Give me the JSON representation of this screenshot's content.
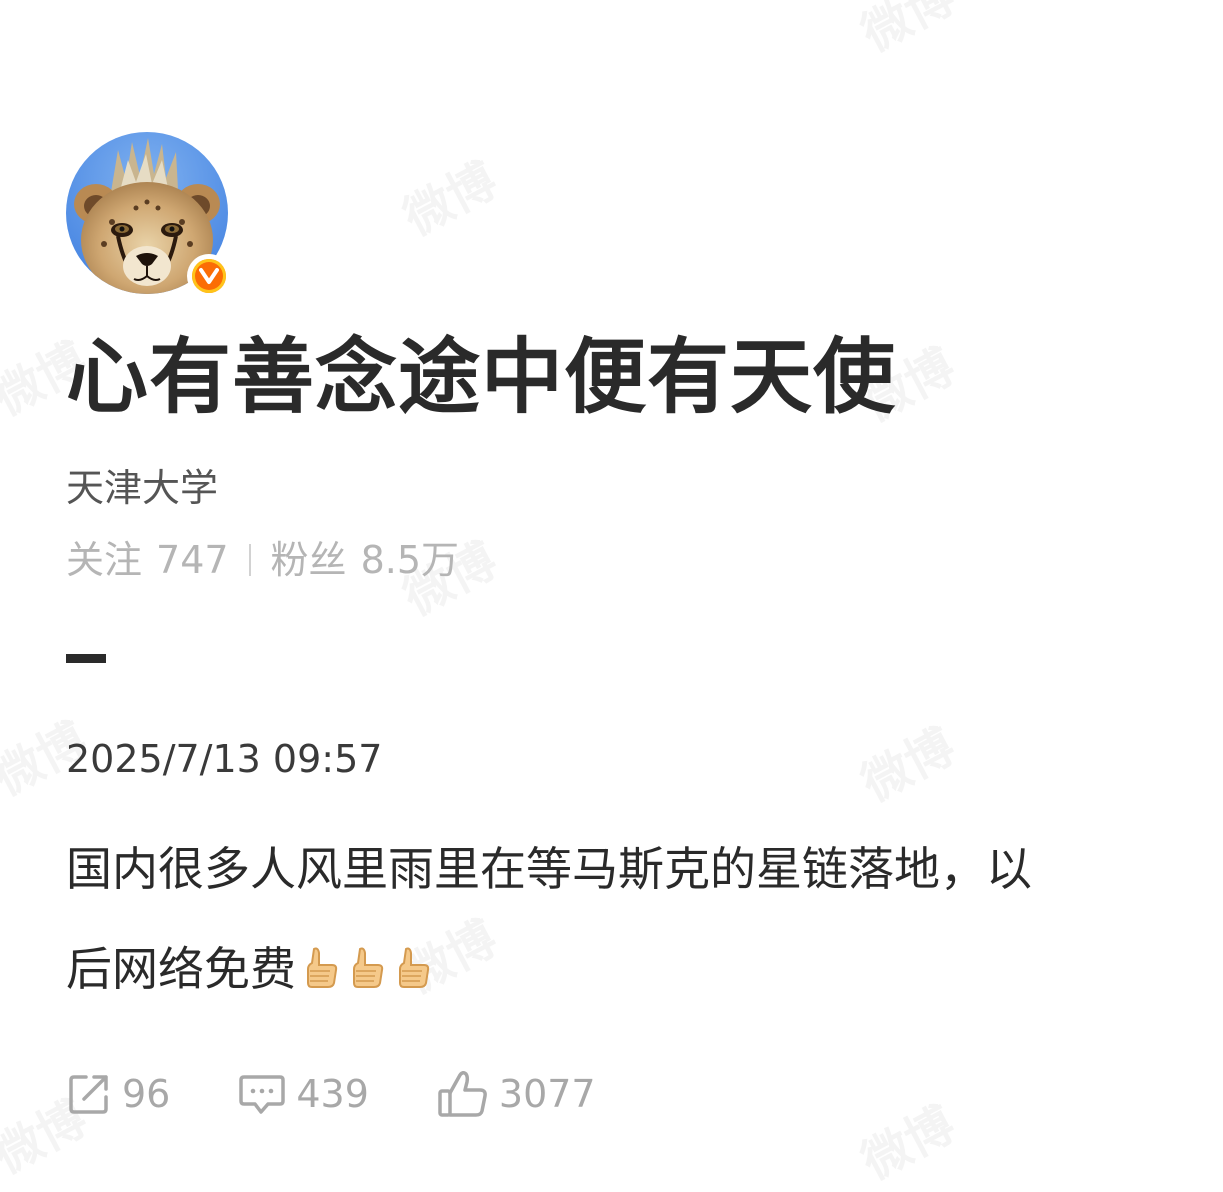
{
  "watermark_text": "微博",
  "profile": {
    "avatar": "cheetah-cub-avatar",
    "verified_badge_letter": "V",
    "username": "心有善念途中便有天使",
    "description": "天津大学",
    "following_label": "关注",
    "following_count": "747",
    "followers_label": "粉丝",
    "followers_count": "8.5万"
  },
  "post": {
    "timestamp": "2025/7/13 09:57",
    "text_line1": "国内很多人风里雨里在等马斯克的星链落地，以",
    "text_line2": "后网络免费",
    "emoji": "thumbs-up",
    "emoji_count": 3
  },
  "actions": {
    "repost_count": "96",
    "comment_count": "439",
    "like_count": "3077"
  },
  "colors": {
    "badge_orange": "#fb6d05",
    "badge_ring": "#ffc41a",
    "avatar_sky": "#3f7fe0",
    "text_dark": "#2a2a2a",
    "text_muted": "#b5b5b5"
  }
}
